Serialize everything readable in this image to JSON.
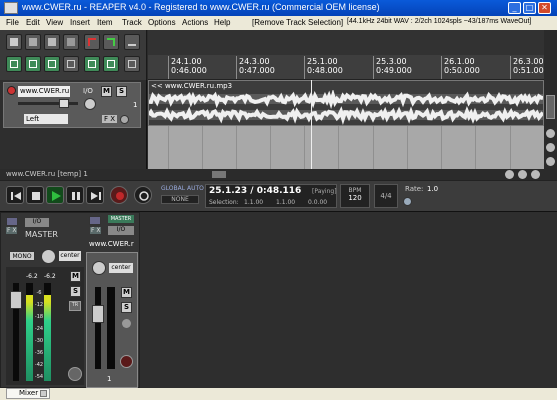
{
  "window": {
    "title": "www.CWER.ru - REAPER v4.0 - Registered to www.CWER.ru (Commercial OEM license)"
  },
  "menu": {
    "items": [
      "File",
      "Edit",
      "View",
      "Insert",
      "Item",
      "Track",
      "Options",
      "Actions",
      "Help"
    ],
    "action_label": "[Remove Track Selection]",
    "status": "[44.1kHz 24bit WAV : 2/2ch 1024spls ~43/187ms WaveOut]"
  },
  "ruler": {
    "markers": [
      {
        "bar": "24.1.00",
        "time": "0:46.000"
      },
      {
        "bar": "24.3.00",
        "time": "0:47.000"
      },
      {
        "bar": "25.1.00",
        "time": "0:48.000"
      },
      {
        "bar": "25.3.00",
        "time": "0:49.000"
      },
      {
        "bar": "26.1.00",
        "time": "0:50.000"
      },
      {
        "bar": "26.3.00",
        "time": "0:51.000"
      }
    ]
  },
  "track": {
    "name": "www.CWER.ru",
    "io_label": "I/O",
    "mute_label": "M",
    "solo_label": "S",
    "fx_label": "F X",
    "channel": "Left",
    "number": "1"
  },
  "item": {
    "title": "<< www.CWER.ru.mp3"
  },
  "project_status": "www.CWER.ru [temp] 1",
  "transport": {
    "global_auto_label": "GLOBAL AUTO",
    "none_label": "NONE",
    "position": "25.1.23 / 0:48.116",
    "state": "[Paying]",
    "selection_label": "Selection:",
    "sel_start": "1.1.00",
    "sel_end": "1.1.00",
    "sel_length": "0.0.00",
    "bpm_label": "BPM",
    "bpm": "120",
    "time_sig": "4/4",
    "rate_label": "Rate:",
    "rate": "1.0"
  },
  "mixer": {
    "master_label": "MASTER",
    "io_label": "I/O",
    "fx_label": "F X",
    "mono_label": "MONO",
    "center_label": "center",
    "meter_peak_l": "-6.2",
    "meter_peak_r": "-6.2",
    "scale": [
      "-6",
      "-12",
      "-18",
      "-24",
      "-30",
      "-36",
      "-42",
      "-54"
    ],
    "mute_label": "M",
    "solo_label": "S",
    "tr_label": "TR",
    "track_name": "www.CWER.r",
    "track_master_label": "MASTER",
    "track_number": "1",
    "tab_label": "Mixer"
  },
  "colors": {
    "titlebar": "#0a5ad9",
    "meter_green": "#2fd08a",
    "meter_yellow": "#d8e020",
    "meter_red": "#e02020",
    "play_green": "#2fbf3f",
    "record_red": "#c0282a"
  }
}
